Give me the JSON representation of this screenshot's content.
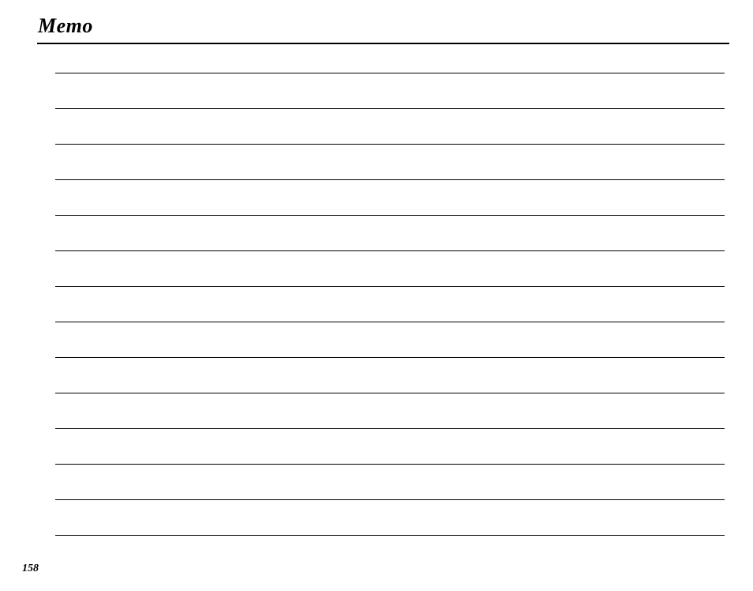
{
  "title": "Memo",
  "page_number": "158",
  "line_count": 14
}
